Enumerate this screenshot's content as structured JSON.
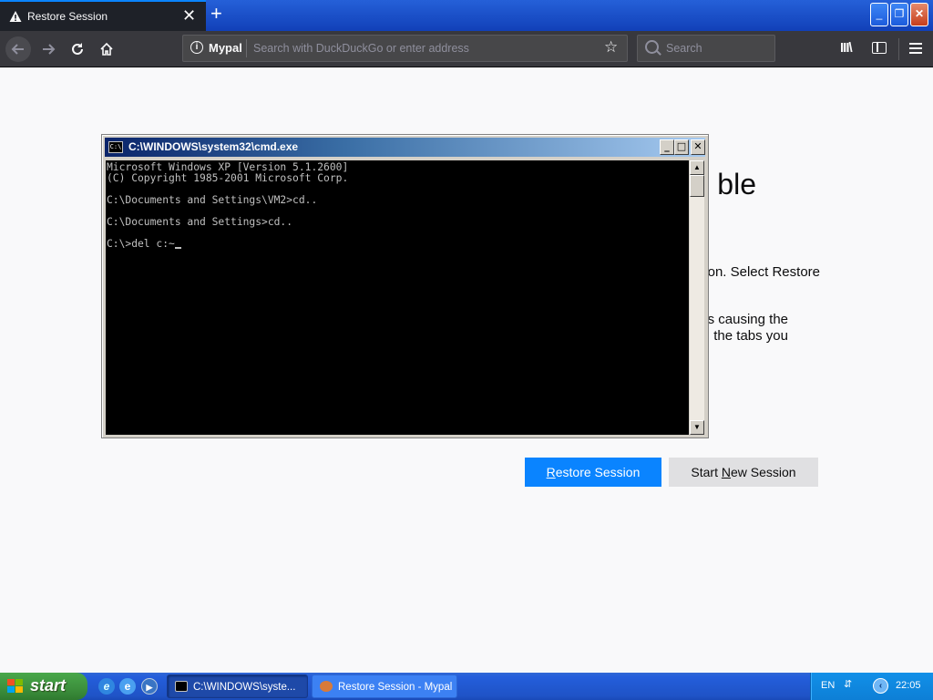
{
  "browser": {
    "tab": {
      "title": "Restore Session"
    },
    "new_tab_symbol": "+",
    "tab_close_symbol": "✕",
    "window_controls": {
      "minimize": "_",
      "maximize": "❐",
      "close": "✕"
    },
    "nav": {
      "identity_label": "Mypal",
      "address_placeholder": "Search with DuckDuckGo or enter address",
      "search_placeholder": "Search"
    },
    "icons": [
      "warning-icon",
      "back-arrow-icon",
      "forward-arrow-icon",
      "reload-icon",
      "home-icon",
      "info-icon",
      "bookmark-star-icon",
      "search-icon",
      "library-icon",
      "sidebar-icon",
      "hamburger-menu-icon"
    ]
  },
  "restore_page": {
    "title_fragment": "ble",
    "desc_line_1_fragment": "ion. Select Restore",
    "desc_line_2_fragment": "s causing the",
    "desc_line_3_fragment": "the tabs you",
    "restore_button": {
      "prefix": "",
      "accel": "R",
      "rest": "estore Session"
    },
    "start_new_button": {
      "prefix": "Start ",
      "accel": "N",
      "rest": "ew Session"
    },
    "accent_color": "#0a84ff"
  },
  "cmd_window": {
    "title": "C:\\WINDOWS\\system32\\cmd.exe",
    "icon_label": "C:\\",
    "console_text": "Microsoft Windows XP [Version 5.1.2600]\n(C) Copyright 1985-2001 Microsoft Corp.\n\nC:\\Documents and Settings\\VM2>cd..\n\nC:\\Documents and Settings>cd..\n\nC:\\>del c:~",
    "buttons": {
      "minimize": "_",
      "maximize": "□",
      "close": "✕"
    },
    "scroll_up": "▲",
    "scroll_down": "▼"
  },
  "taskbar": {
    "start_label": "start",
    "quick_launch": [
      "internet-explorer-icon",
      "ie-alt-icon",
      "media-player-icon"
    ],
    "quick_launch_glyphs": [
      "e",
      "e",
      "▶"
    ],
    "tasks": [
      {
        "label": "C:\\WINDOWS\\syste...",
        "active": true
      },
      {
        "label": "Restore Session - Mypal",
        "active": false
      }
    ],
    "tray": {
      "language": "EN",
      "lang_icon": "⇵",
      "arrow": "‹",
      "clock": "22:05"
    }
  }
}
